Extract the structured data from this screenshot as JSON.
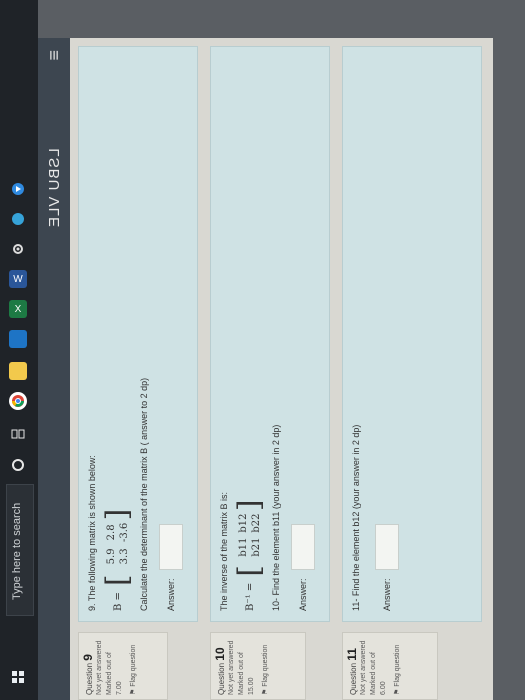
{
  "header": {
    "title": "LSBU VLE",
    "menu_icon": "menu-icon"
  },
  "questions": [
    {
      "label": "Question",
      "number": "9",
      "status": "Not yet answered",
      "marked": "Marked out of",
      "marks": "7.00",
      "flag": "Flag question",
      "text": "9. The following matrix is shown below:",
      "matrix_label": "B =",
      "matrix": [
        "5.9",
        "2.8",
        "3.3",
        "-3.6"
      ],
      "prompt": "Calculate the determinant of the matrix B ( answer to 2 dp)",
      "answer_label": "Answer:"
    },
    {
      "label": "Question",
      "number": "10",
      "status": "Not yet answered",
      "marked": "Marked out of",
      "marks": "15.00",
      "flag": "Flag question",
      "text": "The inverse of the matrix B is:",
      "matrix_label": "B⁻¹ =",
      "matrix": [
        "b11",
        "b12",
        "b21",
        "b22"
      ],
      "prompt": "10- Find the element b11 (your answer in 2 dp)",
      "answer_label": "Answer:"
    },
    {
      "label": "Question",
      "number": "11",
      "status": "Not yet answered",
      "marked": "Marked out of",
      "marks": "6.00",
      "flag": "Flag question",
      "text": "11- Find the element b12 (your answer in 2 dp)",
      "answer_label": "Answer:"
    }
  ],
  "taskbar": {
    "search_placeholder": "Type here to search",
    "icons": [
      "windows-start-icon",
      "cortana-circle-icon",
      "task-view-icon",
      "chrome-icon",
      "file-explorer-icon",
      "mail-icon",
      "excel-icon",
      "word-icon",
      "settings-icon",
      "edge-icon",
      "video-icon"
    ]
  }
}
